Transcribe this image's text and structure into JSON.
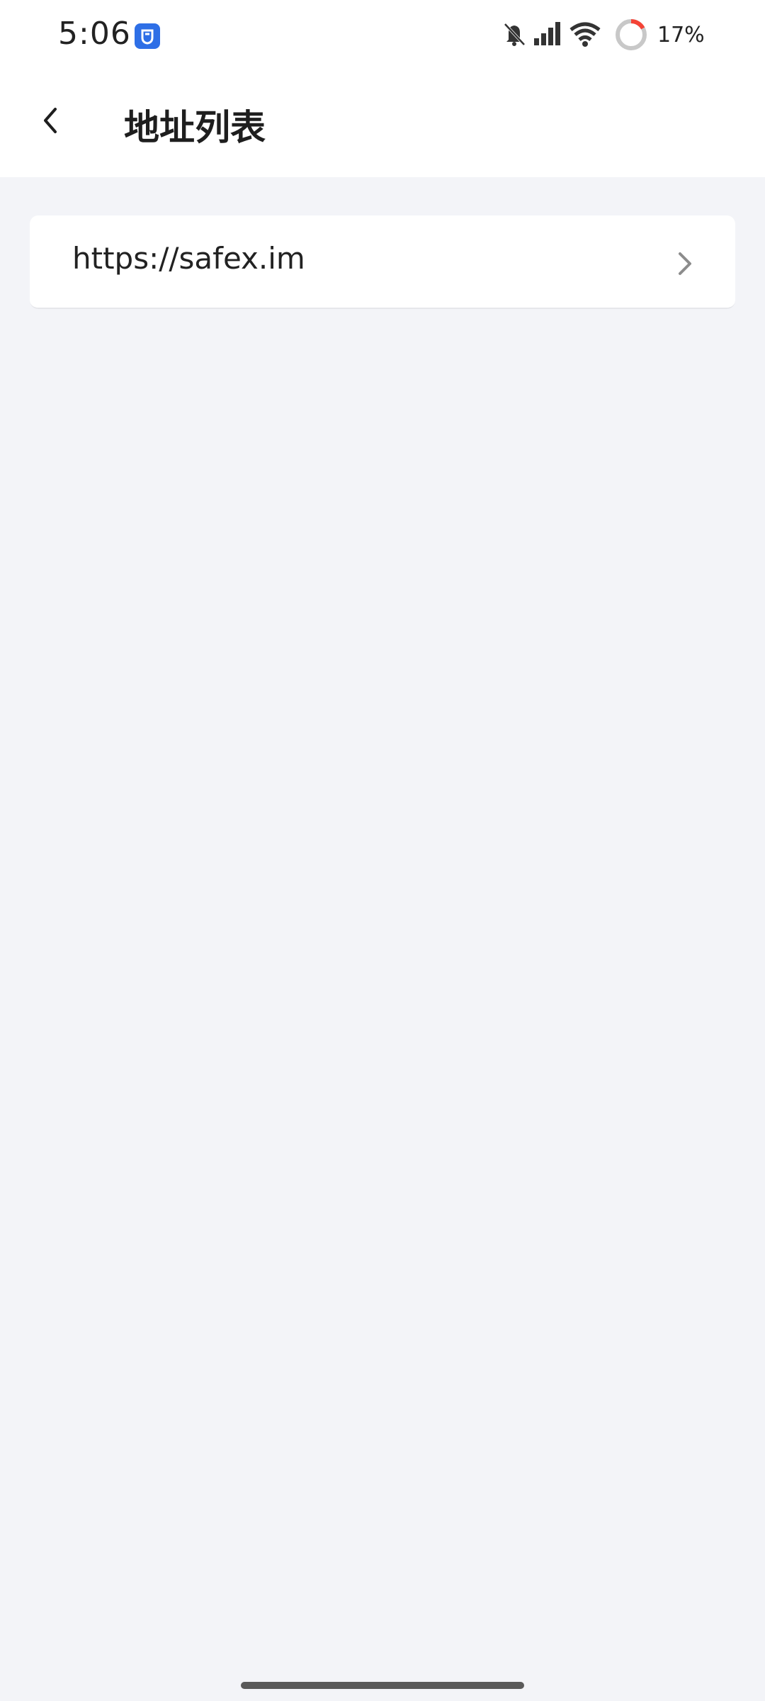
{
  "status_bar": {
    "time": "5:06",
    "battery_percent": "17%",
    "icons": [
      "app-shield-icon",
      "bell-off-icon",
      "signal-icon",
      "wifi-icon",
      "battery-ring-icon"
    ],
    "battery_level": 0.17,
    "battery_color": "#f44336"
  },
  "header": {
    "title": "地址列表",
    "back_icon": "chevron-left-icon"
  },
  "address_list": {
    "items": [
      {
        "label": "https://safex.im",
        "icon": "chevron-right-icon"
      }
    ]
  },
  "colors": {
    "background": "#f3f4f8",
    "card": "#ffffff",
    "accent": "#2e6fe6"
  }
}
